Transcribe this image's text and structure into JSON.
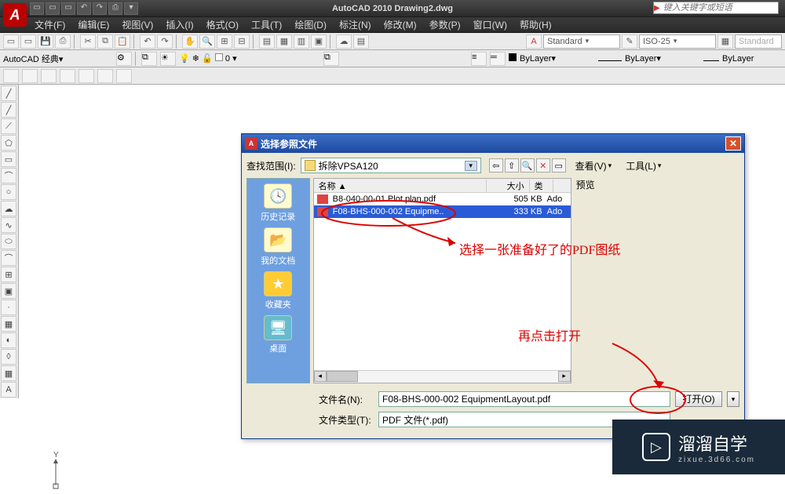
{
  "app": {
    "title": "AutoCAD 2010   Drawing2.dwg",
    "search_placeholder": "键入关键字或短语"
  },
  "menu": [
    "文件(F)",
    "编辑(E)",
    "视图(V)",
    "插入(I)",
    "格式(O)",
    "工具(T)",
    "绘图(D)",
    "标注(N)",
    "修改(M)",
    "参数(P)",
    "窗口(W)",
    "帮助(H)"
  ],
  "top_toolbar": {
    "workspace": "AutoCAD 经典",
    "text_style": "Standard",
    "dim_style": "ISO-25",
    "table_style": "Standard",
    "layer_value": "0",
    "linetype1": "ByLayer",
    "linetype2": "ByLayer",
    "linetype3": "ByLayer"
  },
  "dialog": {
    "title": "选择参照文件",
    "lookin_label": "查找范围(I):",
    "lookin_value": "拆除VPSA120",
    "view_label": "查看(V)",
    "tools_label": "工具(L)",
    "preview_label": "预览",
    "places": [
      "历史记录",
      "我的文档",
      "收藏夹",
      "桌面"
    ],
    "columns": [
      "名称 ▲",
      "大小",
      "类"
    ],
    "files": [
      {
        "name": "B8-040-00-01 Plot plan.pdf",
        "size": "505 KB",
        "type": "Ado"
      },
      {
        "name": "F08-BHS-000-002 Equipme..",
        "size": "333 KB",
        "type": "Ado"
      }
    ],
    "filename_label": "文件名(N):",
    "filename_value": "F08-BHS-000-002 EquipmentLayout.pdf",
    "filetype_label": "文件类型(T):",
    "filetype_value": "PDF 文件(*.pdf)",
    "open_btn": "打开(O)"
  },
  "annotations": {
    "a1": "选择一张准备好了的PDF图纸",
    "a2": "再点击打开"
  },
  "watermark": {
    "text": "溜溜自学",
    "sub": "zixue.3d66.com"
  }
}
